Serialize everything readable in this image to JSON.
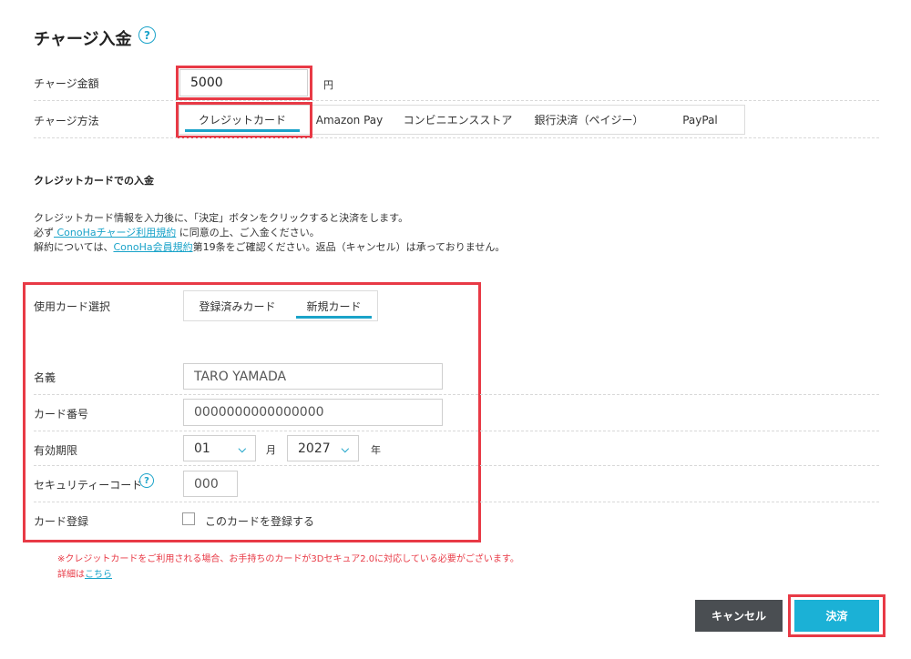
{
  "page": {
    "title": "チャージ入金"
  },
  "charge": {
    "amount_label": "チャージ金額",
    "amount_value": "5000",
    "amount_unit": "円",
    "method_label": "チャージ方法",
    "methods": [
      "クレジットカード",
      "Amazon Pay",
      "コンビニエンスストア",
      "銀行決済（ペイジー）",
      "PayPal"
    ],
    "selected_method": "クレジットカード"
  },
  "credit": {
    "heading": "クレジットカードでの入金",
    "desc1": "クレジットカード情報を入力後に、「決定」ボタンをクリックすると決済をします。",
    "desc2_pre": "必ず",
    "desc2_link": " ConoHaチャージ利用規約",
    "desc2_post": " に同意の上、ご入金ください。",
    "desc3_pre": "解約については、",
    "desc3_link": "ConoHa会員規約",
    "desc3_post": "第19条をご確認ください。返品（キャンセル）は承っておりません。"
  },
  "card_form": {
    "select_label": "使用カード選択",
    "tabs": [
      "登録済みカード",
      "新規カード"
    ],
    "active_tab": "新規カード",
    "name_label": "名義",
    "name_value": "TARO YAMADA",
    "number_label": "カード番号",
    "number_value": "0000000000000000",
    "expiry_label": "有効期限",
    "month_value": "01",
    "month_unit": "月",
    "year_value": "2027",
    "year_unit": "年",
    "cvc_label": "セキュリティーコード",
    "cvc_value": "000",
    "register_label": "カード登録",
    "register_checkbox_label": "このカードを登録する",
    "register_checked": false
  },
  "notice": {
    "line1": "※クレジットカードをご利用される場合、お手持ちのカードが3Dセキュア2.0に対応している必要がございます。",
    "line2_pre": "詳細は",
    "line2_link": "こちら"
  },
  "buttons": {
    "cancel": "キャンセル",
    "submit": "決済"
  },
  "colors": {
    "accent": "#1aa3c9",
    "highlight": "#e83a46",
    "cancel_bg": "#4a4e52",
    "submit_bg": "#1bb1d6"
  },
  "icons": {
    "help": "question-circle-icon",
    "chevron": "chevron-down-icon"
  }
}
